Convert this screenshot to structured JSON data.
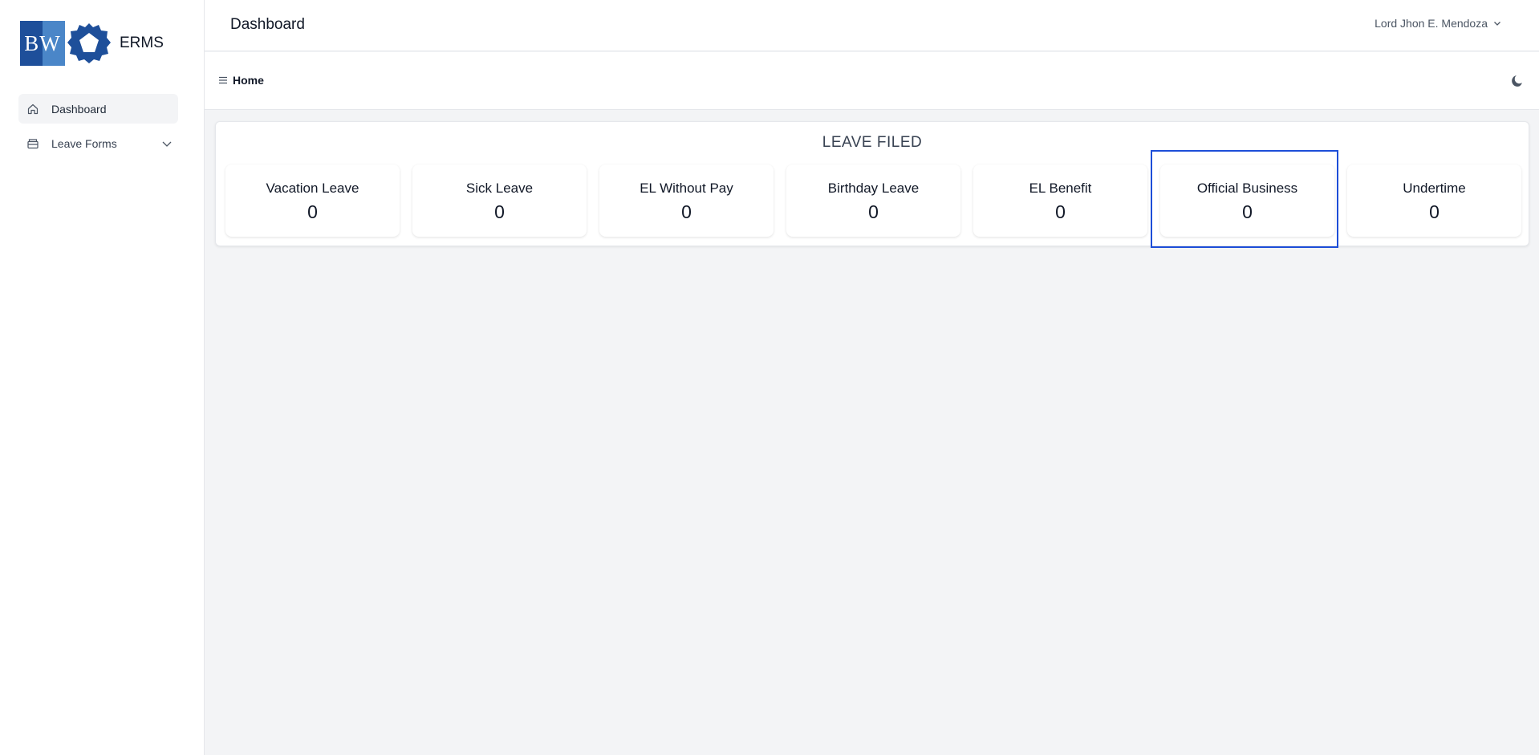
{
  "sidebar": {
    "logo_text": "BW",
    "app_name": "ERMS",
    "items": [
      {
        "label": "Dashboard",
        "icon": "home-icon"
      },
      {
        "label": "Leave Forms",
        "icon": "archive-icon"
      }
    ]
  },
  "header": {
    "title": "Dashboard",
    "user_name": "Lord Jhon E. Mendoza"
  },
  "breadcrumb": {
    "label": "Home"
  },
  "leave_filed": {
    "title": "LEAVE FILED",
    "cards": [
      {
        "label": "Vacation Leave",
        "count": "0"
      },
      {
        "label": "Sick Leave",
        "count": "0"
      },
      {
        "label": "EL Without Pay",
        "count": "0"
      },
      {
        "label": "Birthday Leave",
        "count": "0"
      },
      {
        "label": "EL Benefit",
        "count": "0"
      },
      {
        "label": "Official Business",
        "count": "0"
      },
      {
        "label": "Undertime",
        "count": "0"
      }
    ]
  },
  "colors": {
    "brand_dark": "#1e4f9a",
    "brand_light": "#4a86c8",
    "highlight": "#1d4ed8"
  }
}
